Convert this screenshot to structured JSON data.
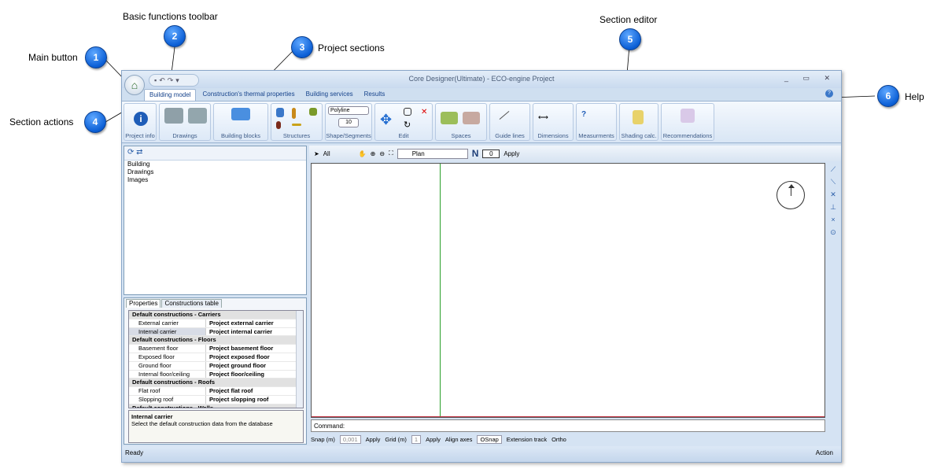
{
  "annotations": {
    "main_button": "Main button",
    "basic_toolbar": "Basic functions toolbar",
    "project_sections": "Project sections",
    "section_actions": "Section actions",
    "section_editor": "Section editor",
    "help": "Help",
    "badges": [
      "1",
      "2",
      "3",
      "4",
      "5",
      "6"
    ]
  },
  "window": {
    "title": "Core Designer(Ultimate) - ECO-engine Project",
    "controls": "_ ▭ ✕"
  },
  "tabs": [
    "Building model",
    "Construction's thermal properties",
    "Building services",
    "Results"
  ],
  "ribbon": {
    "groups": [
      "Project info",
      "Drawings",
      "Building blocks",
      "Structures",
      "Shape/Segments",
      "Edit",
      "Spaces",
      "Guide lines",
      "Dimensions",
      "Measurments",
      "Shading calc.",
      "Recommendations"
    ],
    "polyline": "Polyline",
    "segments": "10"
  },
  "tree": {
    "items": [
      "Building",
      "Drawings",
      "Images"
    ]
  },
  "props": {
    "tabs": [
      "Properties",
      "Constructions table"
    ],
    "rows": [
      {
        "cat": true,
        "k": "Default constructions - Carriers",
        "v": ""
      },
      {
        "cat": false,
        "k": "External carrier",
        "v": "Project external carrier"
      },
      {
        "cat": false,
        "k": "Internal carrier",
        "v": "Project internal carrier"
      },
      {
        "cat": true,
        "k": "Default constructions - Floors",
        "v": ""
      },
      {
        "cat": false,
        "k": "Basement floor",
        "v": "Project basement floor"
      },
      {
        "cat": false,
        "k": "Exposed floor",
        "v": "Project exposed floor"
      },
      {
        "cat": false,
        "k": "Ground floor",
        "v": "Project ground floor"
      },
      {
        "cat": false,
        "k": "Internal floor/ceiling",
        "v": "Project floor/ceiling"
      },
      {
        "cat": true,
        "k": "Default constructions - Roofs",
        "v": ""
      },
      {
        "cat": false,
        "k": "Flat roof",
        "v": "Project flat roof"
      },
      {
        "cat": false,
        "k": "Slopping roof",
        "v": "Project slopping roof"
      },
      {
        "cat": true,
        "k": "Default constructions - Walls",
        "v": ""
      }
    ],
    "desc_title": "Internal carrier",
    "desc_text": "Select the default construction data from the database"
  },
  "editor": {
    "filter": "All",
    "view": "Plan",
    "angle": "0",
    "apply": "Apply",
    "command_label": "Command:"
  },
  "status": {
    "snap_label": "Snap (m)",
    "snap_val": "0,001",
    "apply": "Apply",
    "grid_label": "Grid (m)",
    "grid_val": "1",
    "align": "Align axes",
    "osnap": "OSnap",
    "ext": "Extension track",
    "ortho": "Ortho",
    "ready": "Ready",
    "action": "Action"
  }
}
